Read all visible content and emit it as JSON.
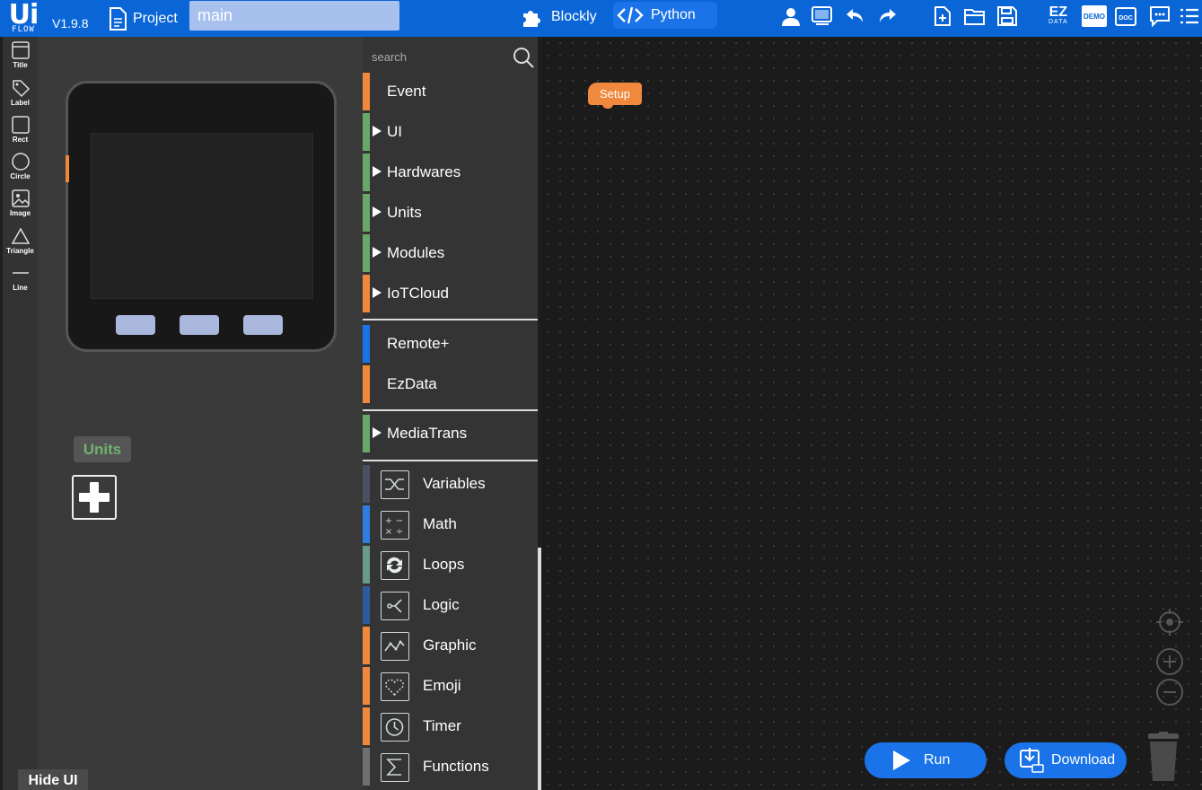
{
  "app": {
    "logo_top": "Ui",
    "logo_bottom": "FLOW",
    "version": "V1.9.8",
    "project_label": "Project",
    "file_name": "main",
    "modes": {
      "blockly": "Blockly",
      "python": "Python"
    },
    "ez_data": {
      "top": "EZ",
      "bottom": "DATA"
    },
    "demo_label": "DEMO",
    "doc_label": "DOC",
    "accent_color": "#0a66d6"
  },
  "tools": [
    {
      "label": "Title",
      "icon": "title-icon"
    },
    {
      "label": "Label",
      "icon": "label-icon"
    },
    {
      "label": "Rect",
      "icon": "rect-icon"
    },
    {
      "label": "Circle",
      "icon": "circle-icon"
    },
    {
      "label": "Image",
      "icon": "image-icon"
    },
    {
      "label": "Triangle",
      "icon": "triangle-icon"
    },
    {
      "label": "Line",
      "icon": "line-icon"
    }
  ],
  "device_panel": {
    "units_label": "Units",
    "hide_ui_label": "Hide UI"
  },
  "categories": {
    "search_placeholder": "search",
    "items": [
      {
        "label": "Event",
        "color": "#f0883e",
        "expandable": false
      },
      {
        "label": "UI",
        "color": "#6aa86a",
        "expandable": true
      },
      {
        "label": "Hardwares",
        "color": "#6aa86a",
        "expandable": true
      },
      {
        "label": "Units",
        "color": "#6aa86a",
        "expandable": true
      },
      {
        "label": "Modules",
        "color": "#6aa86a",
        "expandable": true
      },
      {
        "label": "IoTCloud",
        "color": "#f0883e",
        "expandable": true
      },
      {
        "label": "Remote+",
        "color": "#1a73e8",
        "expandable": false
      },
      {
        "label": "EzData",
        "color": "#f0883e",
        "expandable": false
      },
      {
        "label": "MediaTrans",
        "color": "#6aa86a",
        "expandable": true
      },
      {
        "label": "Variables",
        "color": "#4a5060",
        "icon": "variables-icon"
      },
      {
        "label": "Math",
        "color": "#2f7de0",
        "icon": "math-icon"
      },
      {
        "label": "Loops",
        "color": "#6a9a8a",
        "icon": "loops-icon"
      },
      {
        "label": "Logic",
        "color": "#2f5aa0",
        "icon": "logic-icon"
      },
      {
        "label": "Graphic",
        "color": "#f0883e",
        "icon": "graphic-icon"
      },
      {
        "label": "Emoji",
        "color": "#f0883e",
        "icon": "emoji-icon"
      },
      {
        "label": "Timer",
        "color": "#f0883e",
        "icon": "timer-icon"
      },
      {
        "label": "Functions",
        "color": "#707070",
        "icon": "functions-icon"
      }
    ]
  },
  "workspace": {
    "setup_block": "Setup",
    "run_label": "Run",
    "download_label": "Download"
  }
}
